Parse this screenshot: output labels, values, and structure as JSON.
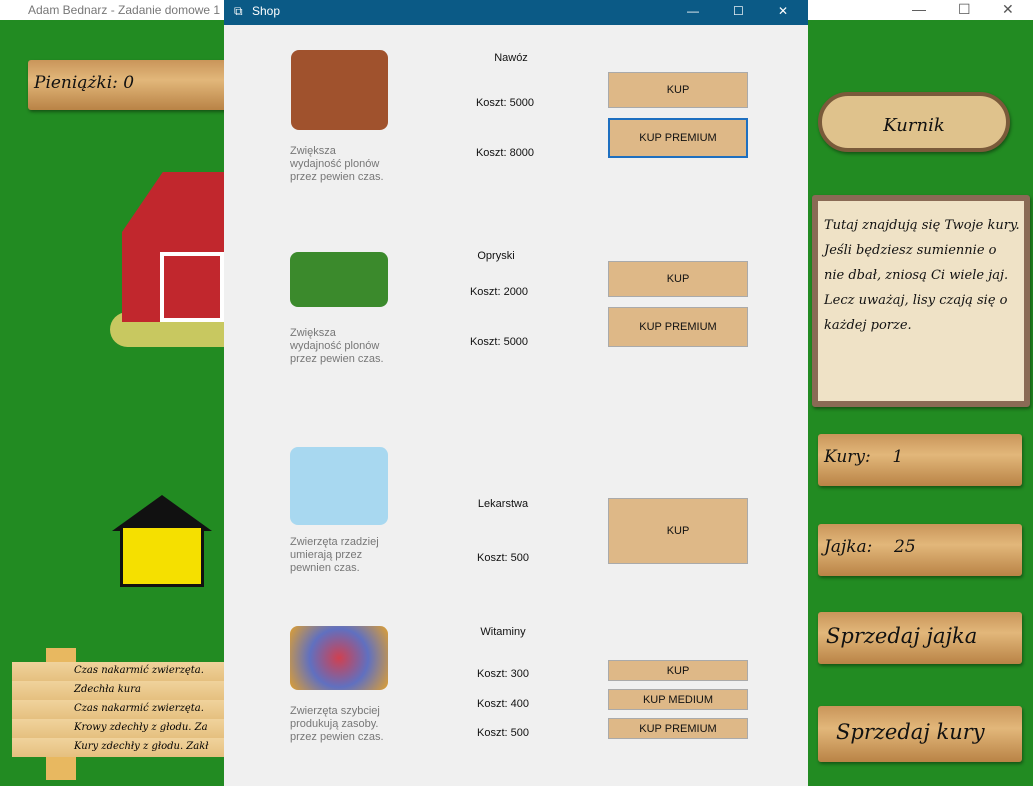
{
  "main_window": {
    "title": "Adam Bednarz - Zadanie domowe 1",
    "money": "Pieniążki: 0",
    "log": [
      "Czas nakarmić zwierzęta.",
      "Zdechła kura",
      "Czas nakarmić zwierzęta.",
      "Krowy zdechły z głodu. Za",
      "Kury zdechły z głodu. Zakł"
    ],
    "kurnik": {
      "title": "Kurnik",
      "description": "Tutaj znajdują się Twoje kury. Jeśli będziesz sumiennie o nie dbał, zniosą Ci wiele jaj. Lecz uważaj, lisy czają się o każdej porze.",
      "hens_label": "Kury:",
      "hens": "1",
      "eggs_label": "Jajka:",
      "eggs": "25",
      "sell_eggs": "Sprzedaj jajka",
      "sell_hens": "Sprzedaj kury"
    }
  },
  "shop": {
    "title": "Shop",
    "items": [
      {
        "name": "Nawóz",
        "desc": "Zwiększa wydajność plonów przez pewien czas.",
        "prices": [
          "Koszt: 5000",
          "Koszt: 8000"
        ],
        "buttons": [
          "KUP",
          "KUP PREMIUM"
        ]
      },
      {
        "name": "Opryski",
        "desc": "Zwiększa wydajność plonów przez pewien czas.",
        "prices": [
          "Koszt: 2000",
          "Koszt: 5000"
        ],
        "buttons": [
          "KUP",
          "KUP PREMIUM"
        ]
      },
      {
        "name": "Lekarstwa",
        "desc": "Zwierzęta rzadziej umierają przez pewnien czas.",
        "prices": [
          "Koszt: 500"
        ],
        "buttons": [
          "KUP"
        ]
      },
      {
        "name": "Witaminy",
        "desc": "Zwierzęta szybciej produkują zasoby. przez pewien czas.",
        "prices": [
          "Koszt: 300",
          "Koszt: 400",
          "Koszt: 500"
        ],
        "buttons": [
          "KUP",
          "KUP MEDIUM",
          "KUP PREMIUM"
        ]
      }
    ]
  }
}
